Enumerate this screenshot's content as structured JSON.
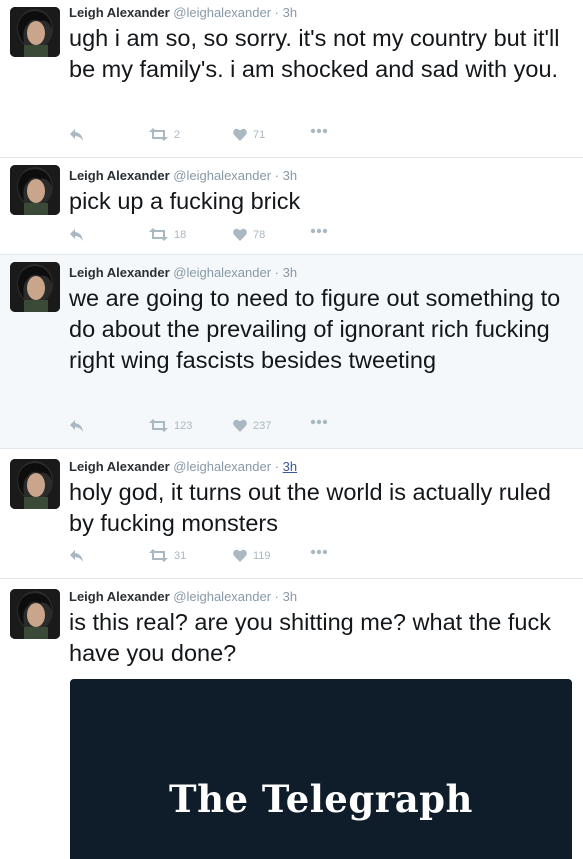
{
  "tweets": [
    {
      "name": "Leigh Alexander",
      "handle": "@leighalexander",
      "time": "3h",
      "text": "ugh i am so, so sorry. it's not my country but it'll be my family's. i am shocked and sad with you.",
      "retweets": "2",
      "likes": "71"
    },
    {
      "name": "Leigh Alexander",
      "handle": "@leighalexander",
      "time": "3h",
      "text": "pick up a fucking brick",
      "retweets": "18",
      "likes": "78"
    },
    {
      "name": "Leigh Alexander",
      "handle": "@leighalexander",
      "time": "3h",
      "text": "we are going to need to figure out something to do about the prevailing of ignorant rich fucking right wing fascists besides tweeting",
      "retweets": "123",
      "likes": "237"
    },
    {
      "name": "Leigh Alexander",
      "handle": "@leighalexander",
      "time": "3h",
      "text": "holy god, it turns out the world is actually ruled by fucking monsters",
      "retweets": "31",
      "likes": "119"
    },
    {
      "name": "Leigh Alexander",
      "handle": "@leighalexander",
      "time": "3h",
      "text": "is this real? are you shitting me? what the fuck have you done?",
      "card_logo": "The Telegraph"
    }
  ],
  "separator": "·",
  "colors": {
    "text": "#14171a",
    "secondary": "#8899a6",
    "action": "#aab8c2",
    "highlight_bg": "#f5f8fa",
    "card_bg": "#0f1d2a",
    "link": "#3b5998"
  },
  "icons": [
    "reply-icon",
    "retweet-icon",
    "heart-icon",
    "more-icon"
  ]
}
